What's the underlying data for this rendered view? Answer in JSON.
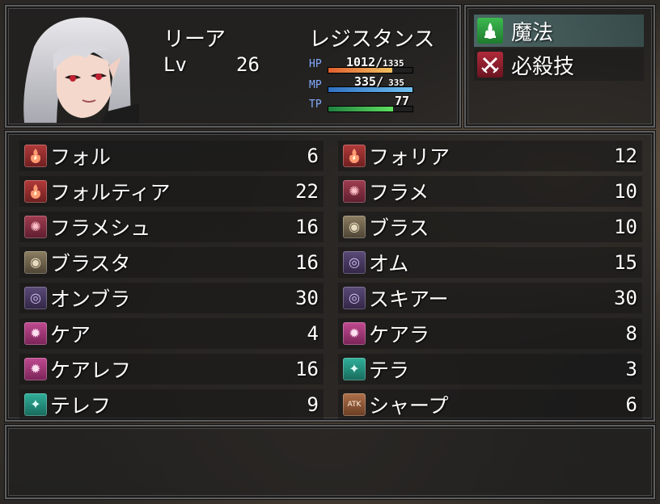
{
  "actor": {
    "name": "リーア",
    "class": "レジスタンス",
    "level_label": "Lv",
    "level": "26",
    "hp_label": "HP",
    "hp": "1012",
    "hp_max": "1335",
    "hp_ratio": 0.758,
    "mp_label": "MP",
    "mp": "335",
    "mp_max": "335",
    "mp_ratio": 1.0,
    "tp_label": "TP",
    "tp": "77",
    "tp_ratio": 0.77,
    "slash": "/",
    "colors": {
      "hp": "#f0a040",
      "mp": "#4aa0e0",
      "tp": "#40c050",
      "system": "#84aaff"
    }
  },
  "commands": [
    {
      "label": "魔法",
      "icon": "magic-icon",
      "selected": true
    },
    {
      "label": "必殺技",
      "icon": "crossed-swords-icon",
      "selected": false
    }
  ],
  "skills": [
    {
      "name": "フォル",
      "cost": "6",
      "icon": "fire-icon",
      "kind": "fire"
    },
    {
      "name": "フォリア",
      "cost": "12",
      "icon": "fire-icon",
      "kind": "fire"
    },
    {
      "name": "フォルティア",
      "cost": "22",
      "icon": "fire-icon",
      "kind": "fire"
    },
    {
      "name": "フラメ",
      "cost": "10",
      "icon": "wind-icon",
      "kind": "wind"
    },
    {
      "name": "フラメシュ",
      "cost": "16",
      "icon": "wind-icon",
      "kind": "wind"
    },
    {
      "name": "ブラス",
      "cost": "10",
      "icon": "rock-icon",
      "kind": "earth"
    },
    {
      "name": "ブラスタ",
      "cost": "16",
      "icon": "rock-icon",
      "kind": "earth"
    },
    {
      "name": "オム",
      "cost": "15",
      "icon": "vortex-icon",
      "kind": "dark"
    },
    {
      "name": "オンブラ",
      "cost": "30",
      "icon": "vortex-icon",
      "kind": "dark"
    },
    {
      "name": "スキアー",
      "cost": "30",
      "icon": "shadow-icon",
      "kind": "dark"
    },
    {
      "name": "ケア",
      "cost": "4",
      "icon": "heal-icon",
      "kind": "heal"
    },
    {
      "name": "ケアラ",
      "cost": "8",
      "icon": "heal-icon",
      "kind": "heal"
    },
    {
      "name": "ケアレフ",
      "cost": "16",
      "icon": "heal-icon",
      "kind": "heal"
    },
    {
      "name": "テラ",
      "cost": "3",
      "icon": "sparkle-icon",
      "kind": "light"
    },
    {
      "name": "テレフ",
      "cost": "9",
      "icon": "sparkle-icon",
      "kind": "light"
    },
    {
      "name": "シャープ",
      "cost": "6",
      "icon": "atk-up-icon",
      "kind": "atk",
      "icon_text": "ATK"
    }
  ],
  "help": {
    "text": ""
  }
}
